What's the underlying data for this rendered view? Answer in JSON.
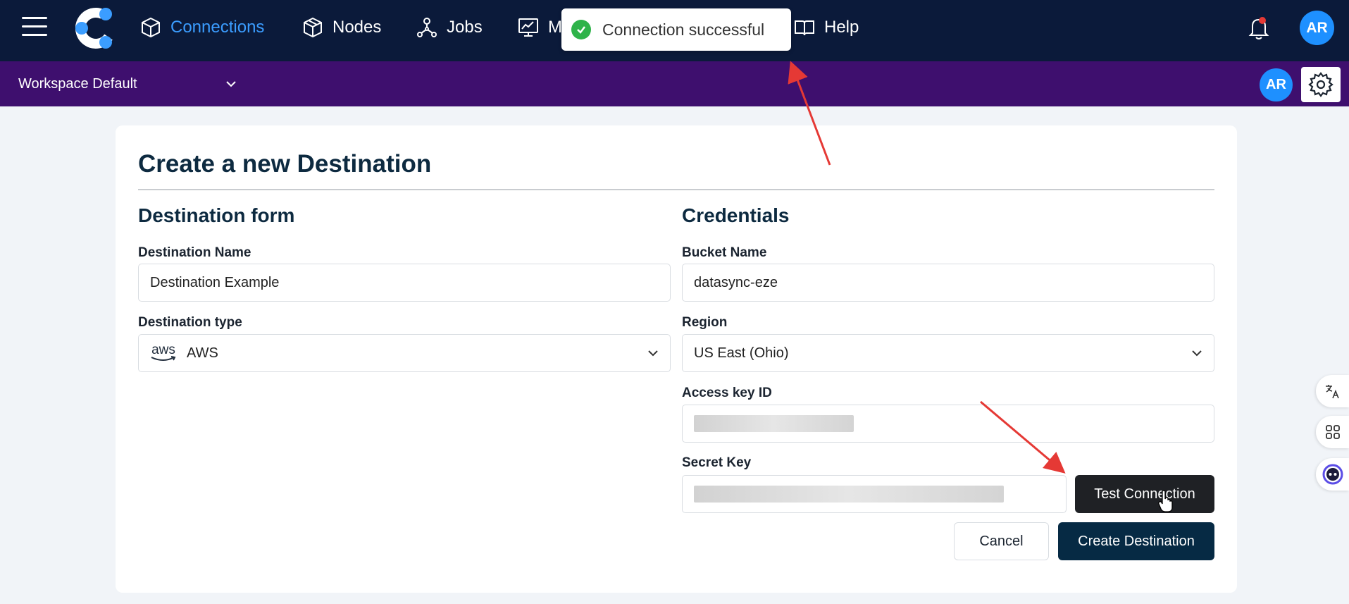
{
  "nav": {
    "items": [
      {
        "label": "Connections",
        "icon": "cube-icon",
        "active": true
      },
      {
        "label": "Nodes",
        "icon": "box-icon"
      },
      {
        "label": "Jobs",
        "icon": "network-icon"
      },
      {
        "label": "M",
        "icon": "monitor-chart-icon"
      },
      {
        "label": "Help",
        "icon": "book-icon"
      }
    ],
    "avatar_initials": "AR"
  },
  "toast": {
    "message": "Connection successful",
    "status_color": "#2fb34a"
  },
  "workspace": {
    "name": "Workspace Default",
    "avatar_initials": "AR"
  },
  "page": {
    "title": "Create a new Destination"
  },
  "destination_form": {
    "title": "Destination form",
    "name_label": "Destination Name",
    "name_value": "Destination Example",
    "type_label": "Destination type",
    "type_value": "AWS",
    "type_logo_text": "aws"
  },
  "credentials": {
    "title": "Credentials",
    "bucket_label": "Bucket Name",
    "bucket_value": "datasync-eze",
    "region_label": "Region",
    "region_value": "US East (Ohio)",
    "access_key_label": "Access key ID",
    "secret_key_label": "Secret Key"
  },
  "buttons": {
    "test_connection": "Test Connection",
    "cancel": "Cancel",
    "create": "Create Destination"
  },
  "colors": {
    "topbar": "#0b1a3a",
    "workspace_bar": "#3e0f6e",
    "accent": "#3b9dff",
    "primary_button": "#062a44",
    "annotation_arrow": "#e53935"
  }
}
